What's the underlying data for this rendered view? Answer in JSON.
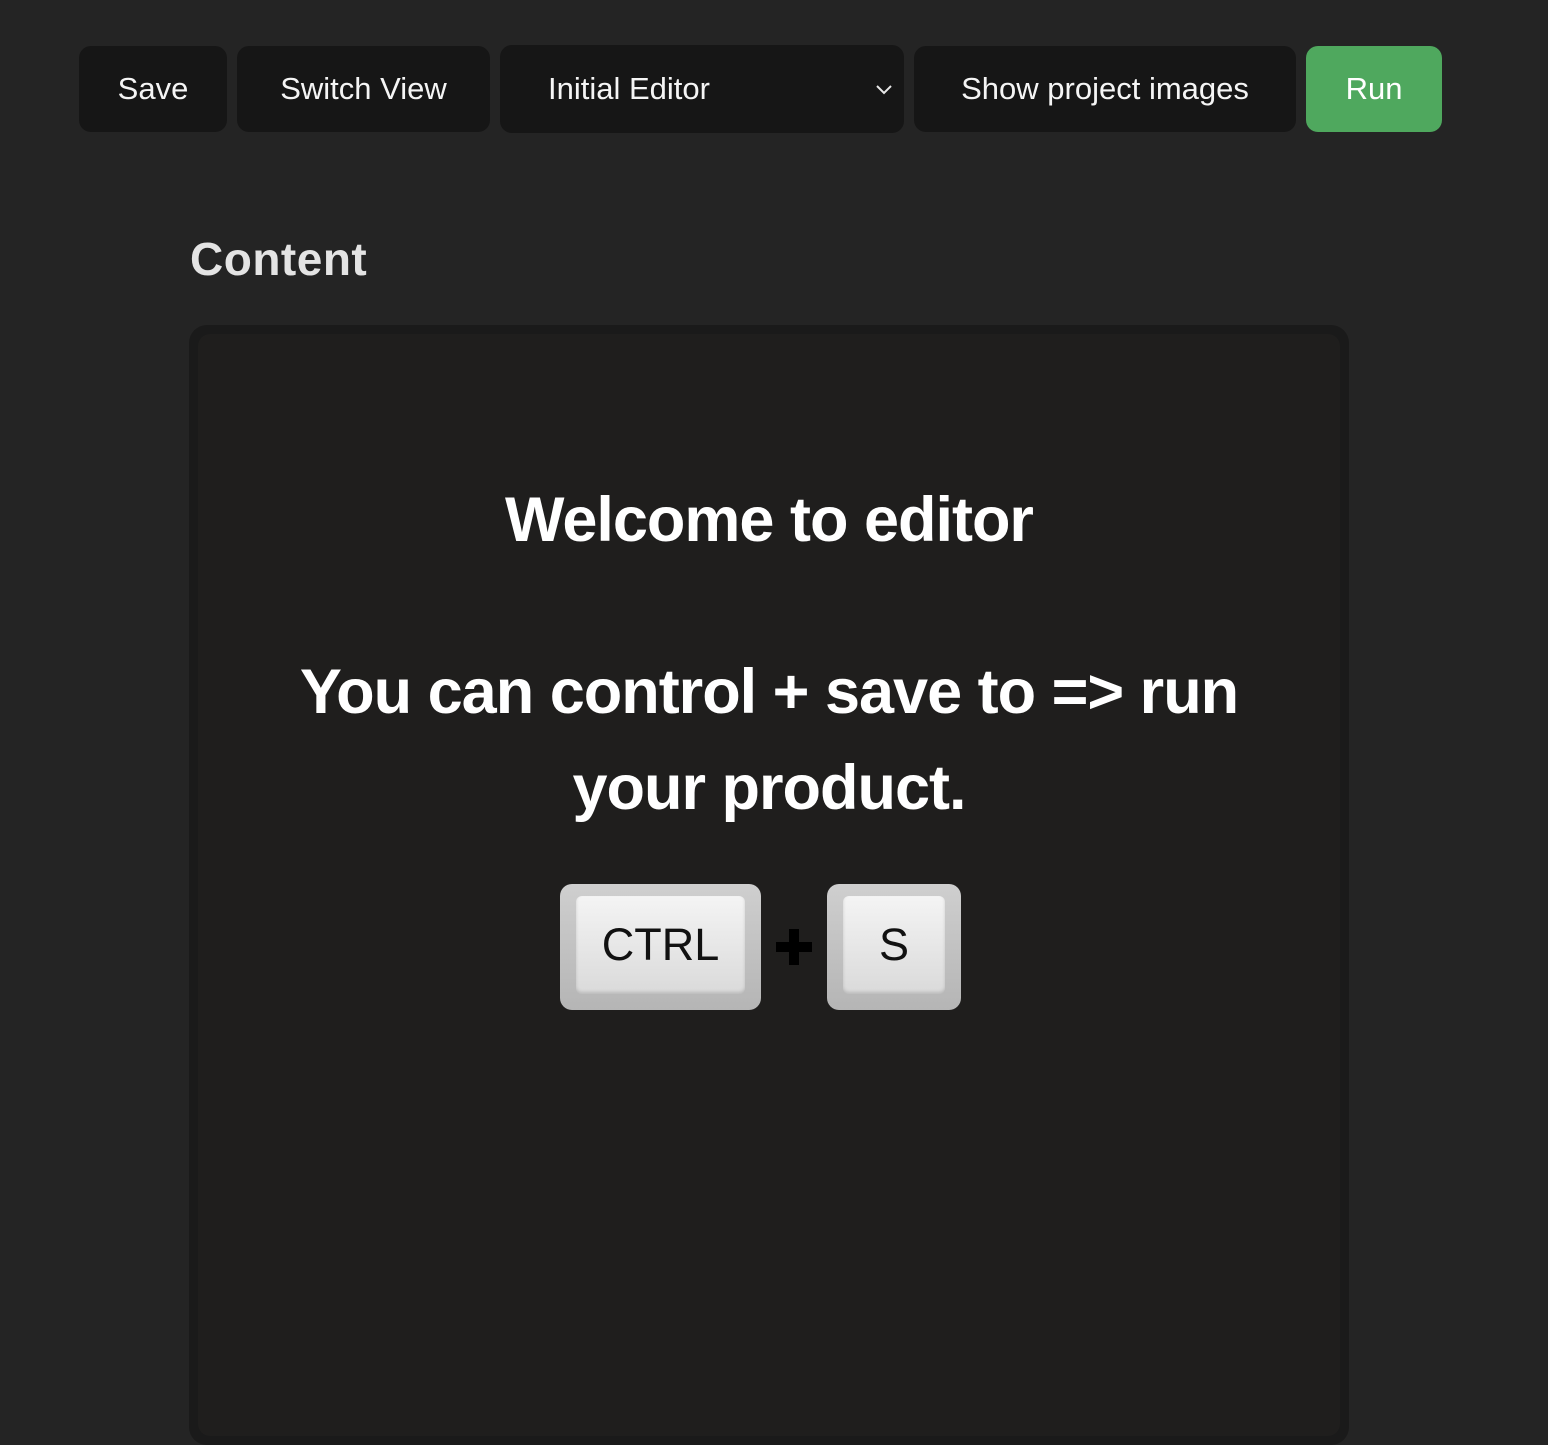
{
  "toolbar": {
    "save_label": "Save",
    "switch_view_label": "Switch View",
    "editor_select": {
      "selected": "Initial Editor",
      "icon": "chevron-down-icon"
    },
    "show_images_label": "Show project images",
    "run_label": "Run"
  },
  "colors": {
    "background": "#242424",
    "button_bg": "#161616",
    "run_accent": "#4fa85e",
    "content_bg": "#1f1e1d"
  },
  "content": {
    "title": "Content",
    "welcome": "Welcome to editor",
    "description": "You can control + save to => run your product.",
    "shortcut": {
      "key1": "CTRL",
      "key2": "S",
      "separator_icon": "plus-icon"
    }
  }
}
